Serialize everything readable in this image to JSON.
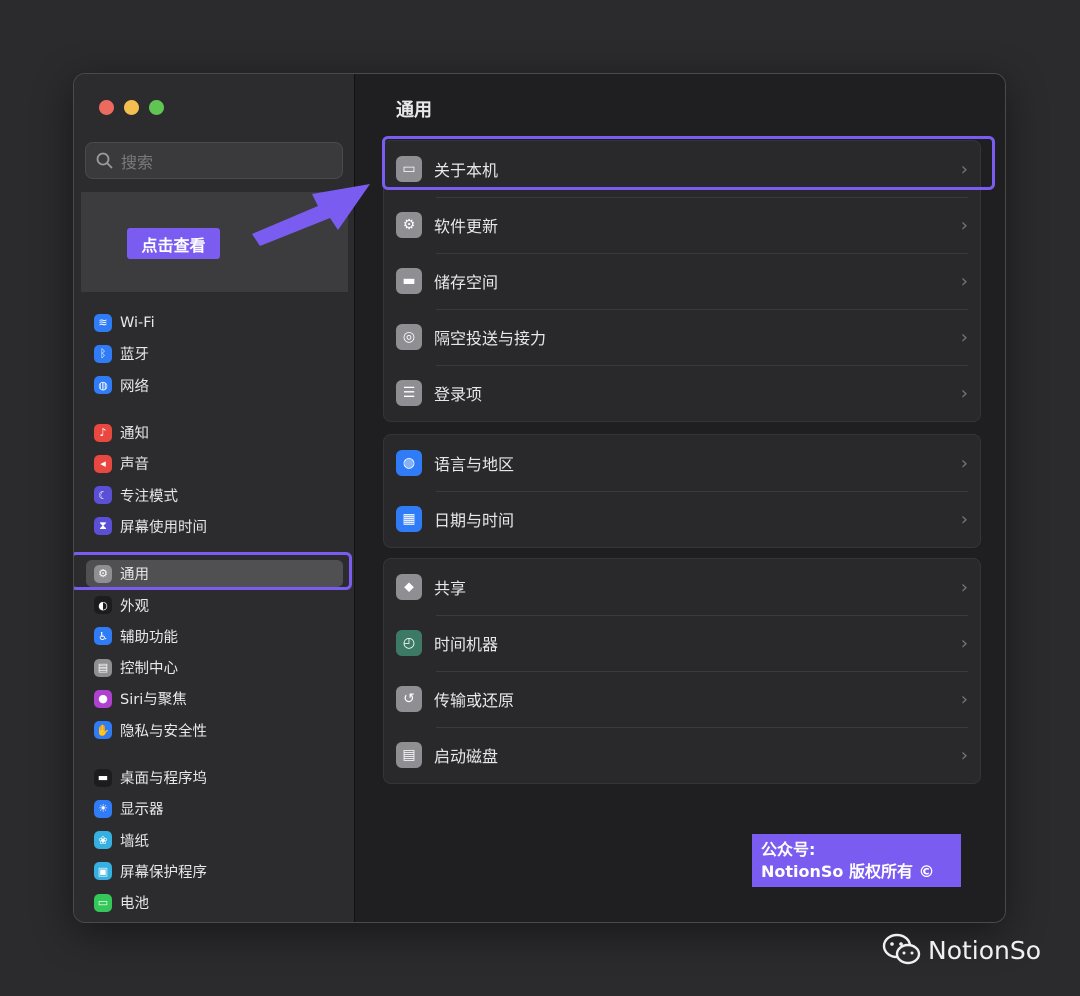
{
  "search": {
    "placeholder": "搜索"
  },
  "annotation": {
    "label": "点击查看"
  },
  "sidebar": {
    "groups": [
      [
        {
          "label": "Wi-Fi",
          "icon": "wifi-icon",
          "color": "#2f7cf6"
        },
        {
          "label": "蓝牙",
          "icon": "bluetooth-icon",
          "color": "#2f7cf6"
        },
        {
          "label": "网络",
          "icon": "globe-icon",
          "color": "#2f7cf6"
        }
      ],
      [
        {
          "label": "通知",
          "icon": "bell-icon",
          "color": "#e8483f"
        },
        {
          "label": "声音",
          "icon": "speaker-icon",
          "color": "#e8483f"
        },
        {
          "label": "专注模式",
          "icon": "moon-icon",
          "color": "#5b4fd6"
        },
        {
          "label": "屏幕使用时间",
          "icon": "hourglass-icon",
          "color": "#5b4fd6"
        }
      ],
      [
        {
          "label": "通用",
          "icon": "gear-icon",
          "color": "#8e8e93",
          "active": true
        },
        {
          "label": "外观",
          "icon": "appearance-icon",
          "color": "#1c1c1e"
        },
        {
          "label": "辅助功能",
          "icon": "accessibility-icon",
          "color": "#2f7cf6"
        },
        {
          "label": "控制中心",
          "icon": "control-center-icon",
          "color": "#8e8e93"
        },
        {
          "label": "Siri与聚焦",
          "icon": "siri-icon",
          "color": "#b040d0"
        },
        {
          "label": "隐私与安全性",
          "icon": "hand-icon",
          "color": "#2f7cf6"
        }
      ],
      [
        {
          "label": "桌面与程序坞",
          "icon": "dock-icon",
          "color": "#1c1c1e"
        },
        {
          "label": "显示器",
          "icon": "sun-icon",
          "color": "#2f7cf6"
        },
        {
          "label": "墙纸",
          "icon": "wallpaper-icon",
          "color": "#35b0e0"
        },
        {
          "label": "屏幕保护程序",
          "icon": "screensaver-icon",
          "color": "#35b0e0"
        },
        {
          "label": "电池",
          "icon": "battery-icon",
          "color": "#34c759"
        }
      ]
    ]
  },
  "main": {
    "title": "通用",
    "groups": [
      [
        {
          "label": "关于本机",
          "icon": "laptop-icon",
          "color": "#8e8e93"
        },
        {
          "label": "软件更新",
          "icon": "gear-icon",
          "color": "#8e8e93"
        },
        {
          "label": "储存空间",
          "icon": "drive-icon",
          "color": "#8e8e93"
        },
        {
          "label": "隔空投送与接力",
          "icon": "airdrop-icon",
          "color": "#8e8e93"
        },
        {
          "label": "登录项",
          "icon": "list-icon",
          "color": "#8e8e93"
        }
      ],
      [
        {
          "label": "语言与地区",
          "icon": "globe-icon",
          "color": "#2f7cf6"
        },
        {
          "label": "日期与时间",
          "icon": "calendar-icon",
          "color": "#2f7cf6"
        }
      ],
      [
        {
          "label": "共享",
          "icon": "share-icon",
          "color": "#8e8e93"
        },
        {
          "label": "时间机器",
          "icon": "time-machine-icon",
          "color": "#3d7a66"
        },
        {
          "label": "传输或还原",
          "icon": "restore-icon",
          "color": "#8e8e93"
        },
        {
          "label": "启动磁盘",
          "icon": "disk-icon",
          "color": "#8e8e93"
        }
      ]
    ]
  },
  "watermark": {
    "line1": "公众号:",
    "line2": "NotionSo 版权所有 ©"
  },
  "brand": {
    "name": "NotionSo"
  }
}
